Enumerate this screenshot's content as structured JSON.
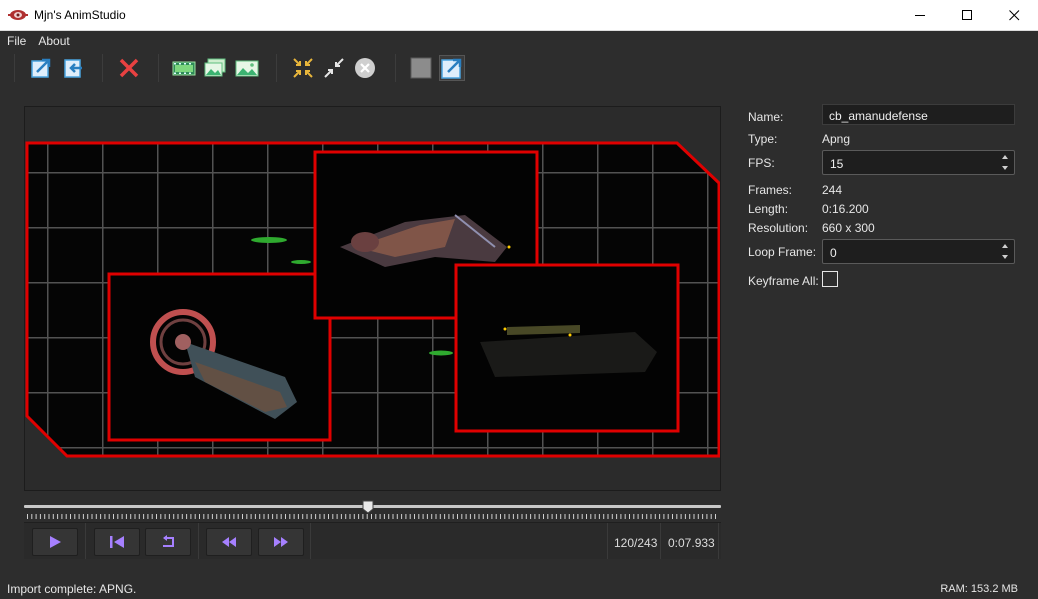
{
  "window": {
    "title": "Mjn's AnimStudio",
    "minimize_icon": "minimize-icon",
    "maximize_icon": "maximize-icon",
    "close_icon": "close-icon"
  },
  "menu": {
    "items": [
      {
        "label": "File"
      },
      {
        "label": "About"
      }
    ]
  },
  "toolbar": {
    "groups": [
      [
        "export-icon",
        "import-icon"
      ],
      [
        "delete-icon"
      ],
      [
        "film-strip-icon",
        "image-stack-icon",
        "image-icon"
      ],
      [
        "collapse-icon",
        "shrink-icon",
        "clear-icon"
      ],
      [
        "fill-square-icon",
        "fit-expand-icon"
      ]
    ],
    "colors": {
      "accent_blue": "#4aa3df",
      "delete_red": "#e84141",
      "green": "#3cb371",
      "gold": "#e8b63b"
    }
  },
  "viewport": {
    "background": "#2b2b2b",
    "frame_border_color": "#e00000",
    "content": "animation preview of game UI panel with three framed sprite views"
  },
  "timeline": {
    "progress": 0.494
  },
  "controls": {
    "play_icon": "play-icon",
    "first_icon": "skip-to-start-icon",
    "loop_icon": "loop-icon",
    "prev_icon": "rewind-icon",
    "next_icon": "fast-forward-icon",
    "frame_counter": "120/243",
    "time": "0:07.933",
    "icon_color": "#a680ff"
  },
  "properties": {
    "name_label": "Name:",
    "name_value": "cb_amanudefense",
    "type_label": "Type:",
    "type_value": "Apng",
    "fps_label": "FPS:",
    "fps_value": "15",
    "frames_label": "Frames:",
    "frames_value": "244",
    "length_label": "Length:",
    "length_value": "0:16.200",
    "resolution_label": "Resolution:",
    "resolution_value": "660 x 300",
    "loop_label": "Loop Frame:",
    "loop_value": "0",
    "keyframe_label": "Keyframe All:",
    "keyframe_checked": false
  },
  "status": {
    "message": "Import complete: APNG.",
    "ram": "RAM: 153.2 MB"
  }
}
